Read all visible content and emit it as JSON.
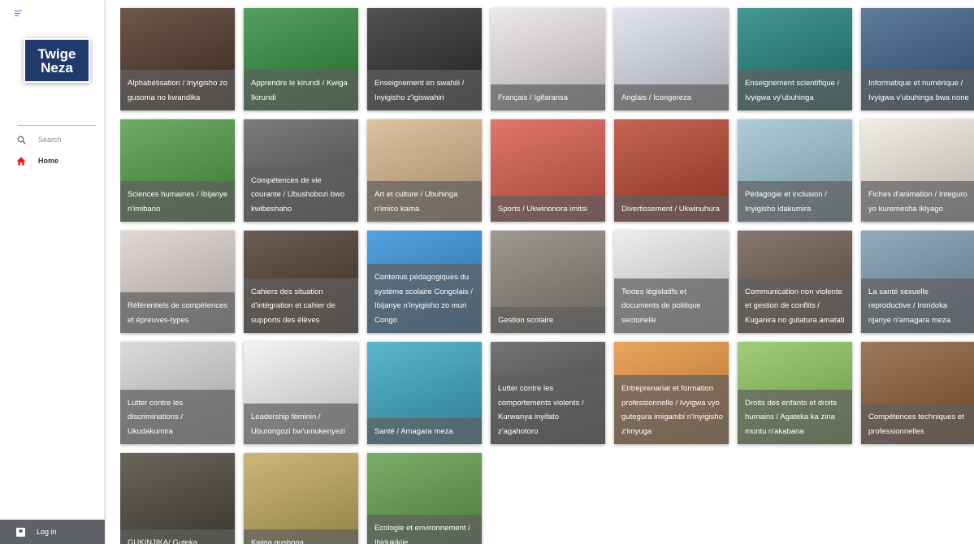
{
  "sidebar": {
    "logo_line1": "Twige",
    "logo_line2": "Neza",
    "search_label": "Search",
    "home_label": "Home",
    "login_label": "Log in",
    "icons": [
      "menu-icon",
      "search-icon",
      "home-icon",
      "user-icon"
    ],
    "colors": {
      "logo_bg": "#1f3a6b",
      "home_icon": "#e02020",
      "login_bg": "#5f6368"
    }
  },
  "tiles": [
    {
      "label": "Alphabétisation / Inyigisho zo gusoma no kwandika",
      "bg": "#4a3424"
    },
    {
      "label": "Apprendre le kirundi / Kwiga Ikirundi",
      "bg": "#2f8a3c"
    },
    {
      "label": "Enseignement en swahili / Inyigisho z'igiswahiri",
      "bg": "#2b2b2b"
    },
    {
      "label": "Français / Igifaransa",
      "bg": "#e9e4e4"
    },
    {
      "label": "Anglais / Icongereza",
      "bg": "#dcdfea"
    },
    {
      "label": "Enseignement scientifique / Ivyigwa vy'ubuhinga",
      "bg": "#1d7f7a"
    },
    {
      "label": "Informatique et numérique / Ivyigwa v'ubuhinga bwa none",
      "bg": "#3b5f86"
    },
    {
      "label": "Sciences humaines / Ibijanye n'imibano",
      "bg": "#4f9a44"
    },
    {
      "label": "Compétences de vie courante / Ubushobozi bwo kwibeshaho",
      "bg": "#5e5e5e"
    },
    {
      "label": "Art et culture / Ubuhinga n'imico kama",
      "bg": "#d8b58a"
    },
    {
      "label": "Sports / Ukwinonora imitsi",
      "bg": "#d85a4a"
    },
    {
      "label": "Divertissement / Ukwinuhura",
      "bg": "#b8432e"
    },
    {
      "label": "Pédagogie et inclusion / Inyigisho idakumira",
      "bg": "#9bc3d1"
    },
    {
      "label": "Fiches d'animation / Integuro yo kuremesha ikiyago",
      "bg": "#efe9df"
    },
    {
      "label": "Référentiels de compétences et épreuves-types",
      "bg": "#d9d0cb"
    },
    {
      "label": "Cahiers des situation d'intégration et cahier de supports des élèves",
      "bg": "#4a3a2e"
    },
    {
      "label": "Contenus pédagogiques du système scolaire Congolais / Ibijanye n'inyigisho zo muri Congo",
      "bg": "#2f8ed8"
    },
    {
      "label": "Gestion scolaire",
      "bg": "#8a8478"
    },
    {
      "label": "Textes législatifs et documents de politique sectorielle",
      "bg": "#e9e9e9"
    },
    {
      "label": "Communication non violente et gestion de conflits / Kuganira no gutatura amatati",
      "bg": "#6b5a4e"
    },
    {
      "label": "La santé sexuelle reproductive / Irondoka rijanye n'amagara meza",
      "bg": "#7a98b0"
    },
    {
      "label": "Lutter contre les discriminations / Ukudakumira",
      "bg": "#d3d3d3"
    },
    {
      "label": "Leadership féminin / Uburongozi bw'umukenyezi",
      "bg": "#f1f1f1"
    },
    {
      "label": "Santé / Amagara meza",
      "bg": "#3aa6c2"
    },
    {
      "label": "Lutter contre les comportements violents / Kurwanya inyifato z'agahotoro",
      "bg": "#565656"
    },
    {
      "label": "Entreprenariat et formation professionnelle / Ivyigwa vyo gutegura imigambi n'inyigisho z'imyuga",
      "bg": "#e5923b"
    },
    {
      "label": "Droits des enfants et droits humains / Agateka ka zina muntu n'akabana",
      "bg": "#8cc35a"
    },
    {
      "label": "Compétences techniques et professionnelles",
      "bg": "#8a5b38"
    },
    {
      "label": "GUKINJIKA/ Guteka",
      "bg": "#4a4436"
    },
    {
      "label": "Kwiga gushona",
      "bg": "#c0a85a"
    },
    {
      "label": "Ecologie et environnement / Ibidukikije",
      "bg": "#5f9c4a"
    }
  ]
}
